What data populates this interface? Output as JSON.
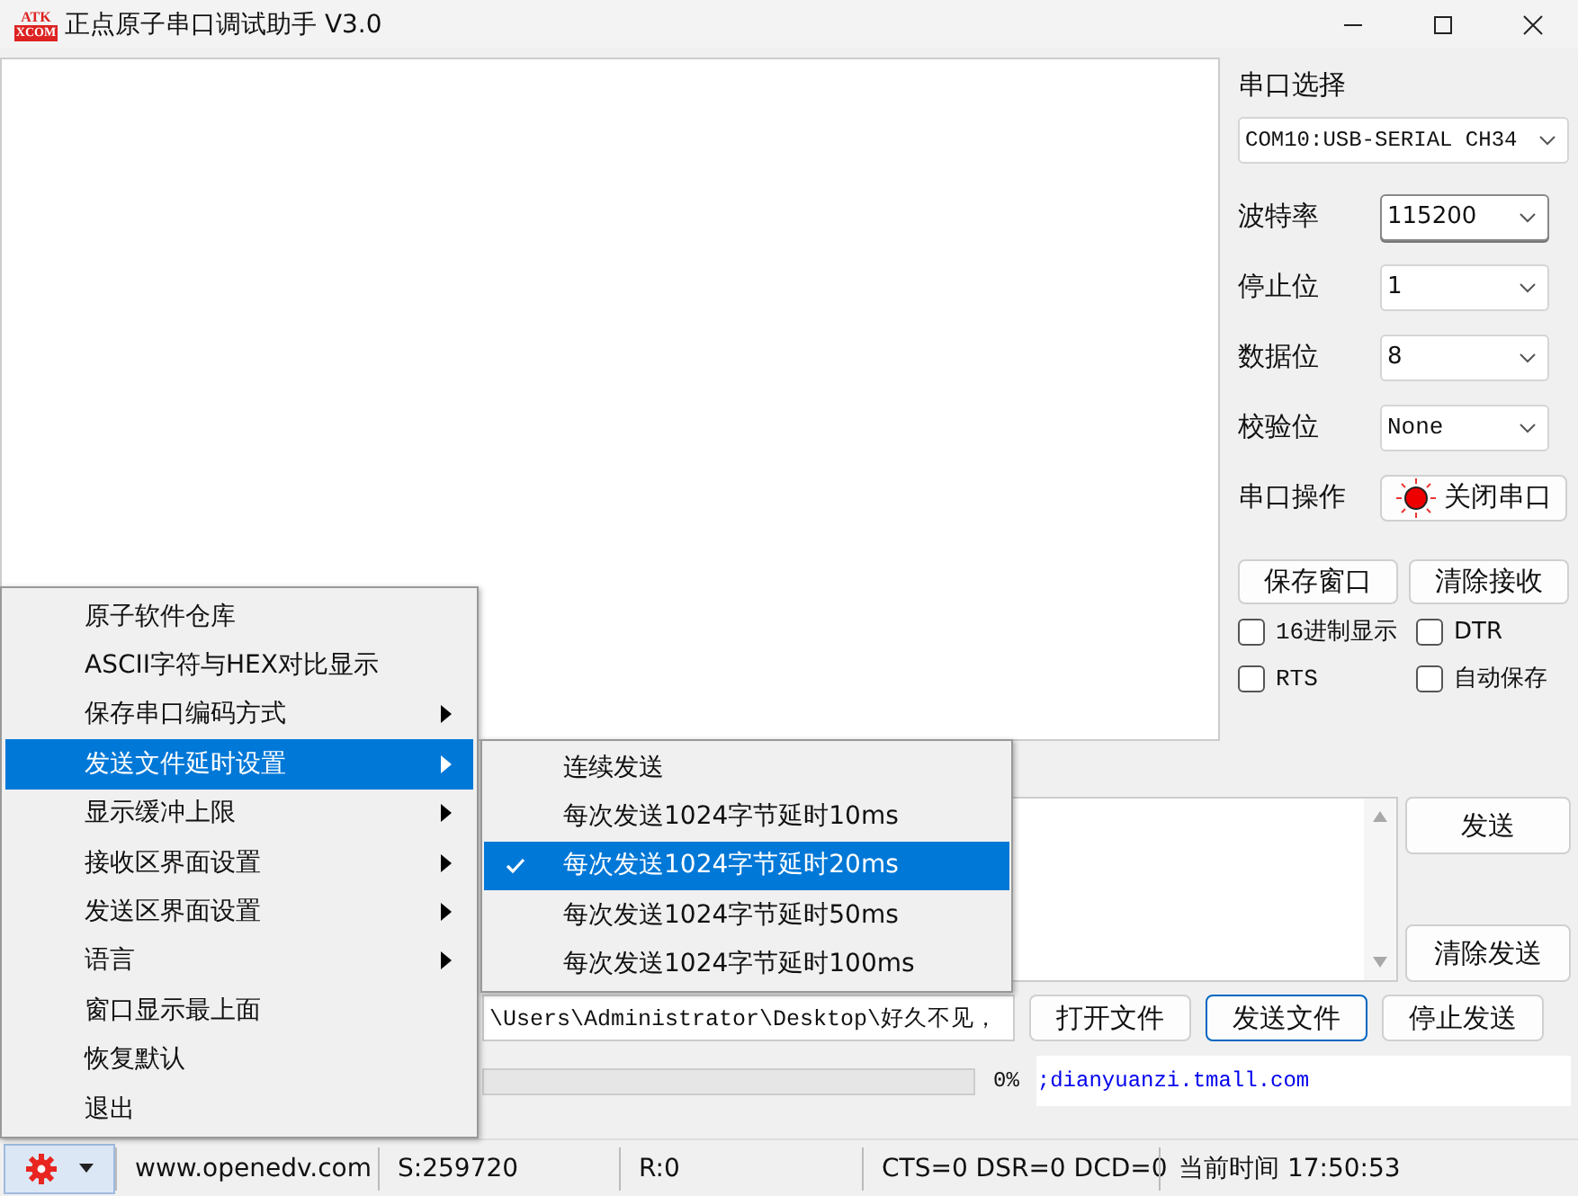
{
  "window": {
    "title": "正点原子串口调试助手 V3.0",
    "logo_top": "ATK",
    "logo_bottom": "XCOM"
  },
  "port_panel": {
    "heading": "串口选择",
    "port": "COM10:USB-SERIAL CH34",
    "fields": [
      {
        "label": "波特率",
        "value": "115200",
        "focused": true
      },
      {
        "label": "停止位",
        "value": "1",
        "focused": false
      },
      {
        "label": "数据位",
        "value": "8",
        "focused": false
      },
      {
        "label": "校验位",
        "value": "None",
        "focused": false
      }
    ],
    "operation_label": "串口操作",
    "operation_button": "关闭串口",
    "port_open": true,
    "buttons": [
      "保存窗口",
      "清除接收"
    ],
    "checkboxes": [
      {
        "label": "16进制显示",
        "checked": false
      },
      {
        "label": "DTR",
        "checked": false
      },
      {
        "label": "RTS",
        "checked": false
      },
      {
        "label": "自动保存",
        "checked": false
      }
    ]
  },
  "send_panel": {
    "send_button": "发送",
    "clear_button": "清除发送",
    "file_path": "\\Users\\Administrator\\Desktop\\好久不见，",
    "file_buttons": [
      {
        "label": "打开文件",
        "focused": false
      },
      {
        "label": "发送文件",
        "focused": true
      },
      {
        "label": "停止发送",
        "focused": false
      }
    ],
    "progress": {
      "level": 0,
      "reading": "0%"
    },
    "link": ";dianyuanzi.tmall.com"
  },
  "menu": {
    "items": [
      {
        "label": "原子软件仓库",
        "submenu": false,
        "selected": false
      },
      {
        "label": "ASCII字符与HEX对比显示",
        "submenu": false,
        "selected": false
      },
      {
        "label": "保存串口编码方式",
        "submenu": true,
        "selected": false
      },
      {
        "label": "发送文件延时设置",
        "submenu": true,
        "selected": true
      },
      {
        "label": "显示缓冲上限",
        "submenu": true,
        "selected": false
      },
      {
        "label": "接收区界面设置",
        "submenu": true,
        "selected": false
      },
      {
        "label": "发送区界面设置",
        "submenu": true,
        "selected": false
      },
      {
        "label": "语言",
        "submenu": true,
        "selected": false
      },
      {
        "label": "窗口显示最上面",
        "submenu": false,
        "selected": false
      },
      {
        "label": "恢复默认",
        "submenu": false,
        "selected": false
      },
      {
        "label": "退出",
        "submenu": false,
        "selected": false
      }
    ],
    "submenu": [
      {
        "label": "连续发送",
        "checked": false,
        "selected": false
      },
      {
        "label": "每次发送1024字节延时10ms",
        "checked": false,
        "selected": false
      },
      {
        "label": "每次发送1024字节延时20ms",
        "checked": true,
        "selected": true
      },
      {
        "label": "每次发送1024字节延时50ms",
        "checked": false,
        "selected": false
      },
      {
        "label": "每次发送1024字节延时100ms",
        "checked": false,
        "selected": false
      }
    ]
  },
  "status_bar": {
    "site": "www.openedv.com",
    "sent": "S:259720",
    "received": "R:0",
    "signals": "CTS=0 DSR=0 DCD=0",
    "time": "当前时间 17:50:53"
  }
}
